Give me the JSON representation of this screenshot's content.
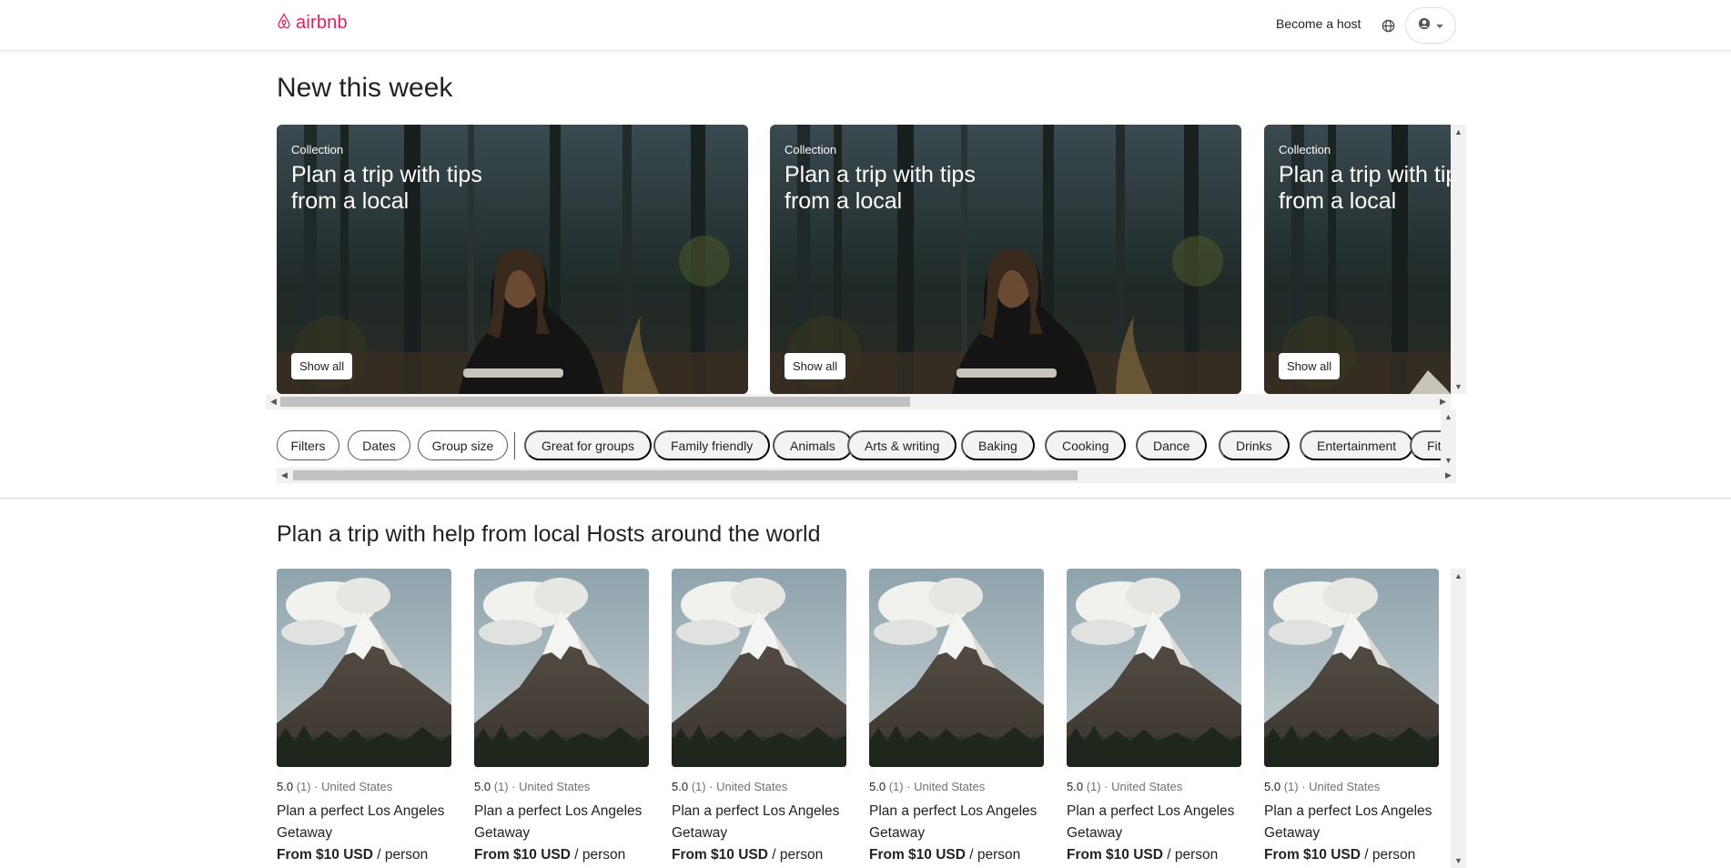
{
  "header": {
    "logo_text": "airbnb",
    "become_host": "Become a host",
    "brand_color": "#e31c5f"
  },
  "section1": {
    "title": "New this week",
    "collections": [
      {
        "kicker": "Collection",
        "title": "Plan a trip with tips from a local",
        "button": "Show all"
      },
      {
        "kicker": "Collection",
        "title": "Plan a trip with tips from a local",
        "button": "Show all"
      },
      {
        "kicker": "Collection",
        "title": "Plan a trip with tips from a local",
        "button": "Show all"
      }
    ]
  },
  "filters": {
    "buttons": [
      "Filters",
      "Dates",
      "Group size"
    ],
    "categories": [
      "Great for groups",
      "Family friendly",
      "Animals",
      "Arts & writing",
      "Baking",
      "Cooking",
      "Dance",
      "Drinks",
      "Entertainment",
      "Fitness"
    ]
  },
  "section2": {
    "title": "Plan a trip with help from local Hosts around the world",
    "experiences": [
      {
        "rating": "5.0",
        "count": "(1)",
        "location": "· United States",
        "title": "Plan a perfect Los Angeles Getaway",
        "price_bold": "From $10 USD",
        "price_unit": "/ person"
      },
      {
        "rating": "5.0",
        "count": "(1)",
        "location": "· United States",
        "title": "Plan a perfect Los Angeles Getaway",
        "price_bold": "From $10 USD",
        "price_unit": "/ person"
      },
      {
        "rating": "5.0",
        "count": "(1)",
        "location": "· United States",
        "title": "Plan a perfect Los Angeles Getaway",
        "price_bold": "From $10 USD",
        "price_unit": "/ person"
      },
      {
        "rating": "5.0",
        "count": "(1)",
        "location": "· United States",
        "title": "Plan a perfect Los Angeles Getaway",
        "price_bold": "From $10 USD",
        "price_unit": "/ person"
      },
      {
        "rating": "5.0",
        "count": "(1)",
        "location": "· United States",
        "title": "Plan a perfect Los Angeles Getaway",
        "price_bold": "From $10 USD",
        "price_unit": "/ person"
      },
      {
        "rating": "5.0",
        "count": "(1)",
        "location": "· United States",
        "title": "Plan a perfect Los Angeles Getaway",
        "price_bold": "From $10 USD",
        "price_unit": "/ person"
      }
    ]
  }
}
